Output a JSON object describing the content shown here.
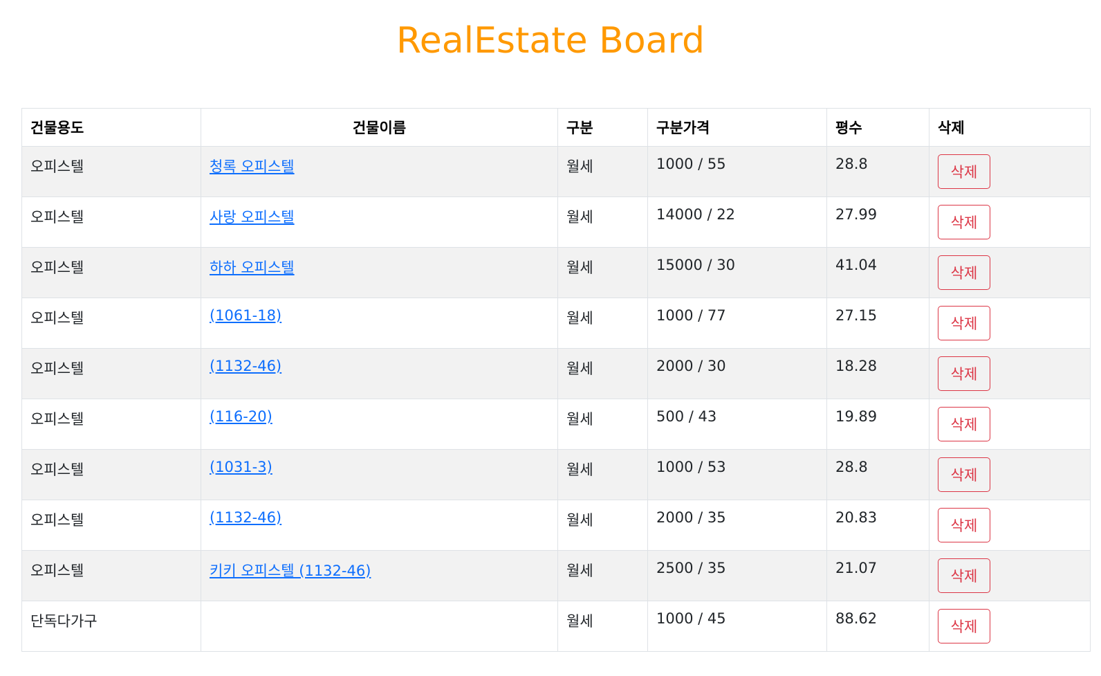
{
  "title": "RealEstate Board",
  "table": {
    "headers": {
      "usage": "건물용도",
      "name": "건물이름",
      "type": "구분",
      "price": "구분가격",
      "area": "평수",
      "delete": "삭제"
    },
    "rows": [
      {
        "usage": "오피스텔",
        "name": "청록 오피스텔",
        "type": "월세",
        "price": "1000 / 55",
        "area": "28.8",
        "delete": "삭제"
      },
      {
        "usage": "오피스텔",
        "name": "사랑 오피스텔",
        "type": "월세",
        "price": "14000 / 22",
        "area": "27.99",
        "delete": "삭제"
      },
      {
        "usage": "오피스텔",
        "name": "하하 오피스텔",
        "type": "월세",
        "price": "15000 / 30",
        "area": "41.04",
        "delete": "삭제"
      },
      {
        "usage": "오피스텔",
        "name": "(1061-18)",
        "type": "월세",
        "price": "1000 / 77",
        "area": "27.15",
        "delete": "삭제"
      },
      {
        "usage": "오피스텔",
        "name": "(1132-46)",
        "type": "월세",
        "price": "2000 / 30",
        "area": "18.28",
        "delete": "삭제"
      },
      {
        "usage": "오피스텔",
        "name": "(116-20)",
        "type": "월세",
        "price": "500 / 43",
        "area": "19.89",
        "delete": "삭제"
      },
      {
        "usage": "오피스텔",
        "name": "(1031-3)",
        "type": "월세",
        "price": "1000 / 53",
        "area": "28.8",
        "delete": "삭제"
      },
      {
        "usage": "오피스텔",
        "name": "(1132-46)",
        "type": "월세",
        "price": "2000 / 35",
        "area": "20.83",
        "delete": "삭제"
      },
      {
        "usage": "오피스텔",
        "name": "키키 오피스텔 (1132-46)",
        "type": "월세",
        "price": "2500 / 35",
        "area": "21.07",
        "delete": "삭제"
      },
      {
        "usage": "단독다가구",
        "name": "",
        "type": "월세",
        "price": "1000 / 45",
        "area": "88.62",
        "delete": "삭제"
      }
    ]
  },
  "colors": {
    "title": "#ff9900",
    "link": "#0d6efd",
    "danger": "#dc3545",
    "stripe": "#f2f2f2"
  }
}
